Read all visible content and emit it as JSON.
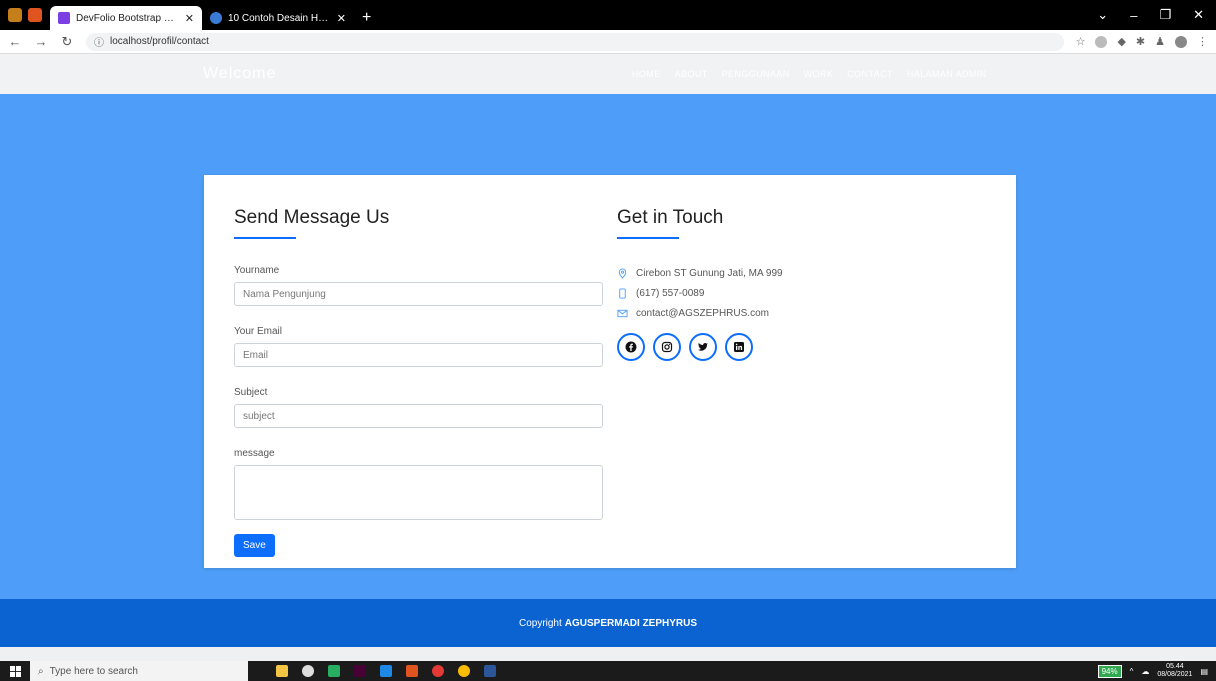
{
  "browser": {
    "tabs": [
      {
        "title": "DevFolio Bootstrap Portfolio Tem",
        "active": true
      },
      {
        "title": "10 Contoh Desain Halaman Cont",
        "active": false
      }
    ],
    "new_tab": "+",
    "url": "localhost/profil/contact"
  },
  "site": {
    "brand": "Welcome",
    "menu": [
      "HOME",
      "ABOUT",
      "PENGGUNAAN",
      "WORK",
      "CONTACT",
      "HALAMAN ADMIN"
    ]
  },
  "form": {
    "heading": "Send Message Us",
    "name_label": "Yourname",
    "name_placeholder": "Nama Pengunjung",
    "email_label": "Your Email",
    "email_placeholder": "Email",
    "subject_label": "Subject",
    "subject_placeholder": "subject",
    "message_label": "message",
    "save_label": "Save"
  },
  "contact": {
    "heading": "Get in Touch",
    "address": "Cirebon ST Gunung Jati, MA 999",
    "phone": "(617) 557-0089",
    "email": "contact@AGSZEPHRUS.com",
    "socials": [
      "facebook-icon",
      "instagram-icon",
      "twitter-icon",
      "linkedin-icon"
    ]
  },
  "footer": {
    "prefix": "Copyright",
    "name": "AGUSPERMADI ZEPHYRUS"
  },
  "taskbar": {
    "search_placeholder": "Type here to search",
    "battery": "94%",
    "time": "05.44",
    "date": "08/08/2021"
  },
  "colors": {
    "hero": "#4e9ef9",
    "primary": "#0d6efd",
    "footer": "#0a63d0"
  }
}
